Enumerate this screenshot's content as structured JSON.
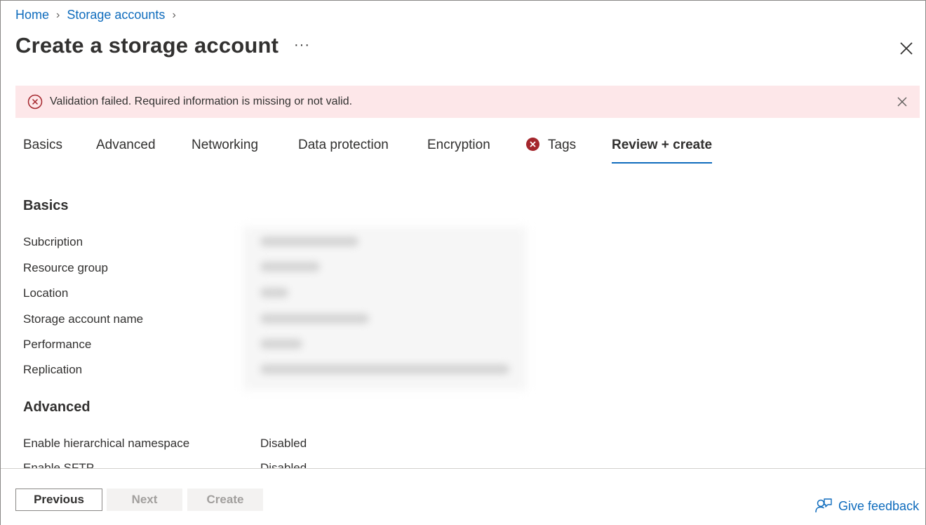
{
  "breadcrumb": {
    "home": "Home",
    "storage_accounts": "Storage accounts"
  },
  "page": {
    "title": "Create a storage account",
    "more": "···"
  },
  "banner": {
    "message": "Validation failed. Required information is missing or not valid."
  },
  "tabs": [
    {
      "label": "Basics"
    },
    {
      "label": "Advanced"
    },
    {
      "label": "Networking"
    },
    {
      "label": "Data protection"
    },
    {
      "label": "Encryption"
    },
    {
      "label": "Tags",
      "has_error": true
    },
    {
      "label": "Review + create",
      "active": true
    }
  ],
  "basics": {
    "heading": "Basics",
    "rows": [
      {
        "label": "Subcription"
      },
      {
        "label": "Resource group"
      },
      {
        "label": "Location"
      },
      {
        "label": "Storage account name"
      },
      {
        "label": "Performance"
      },
      {
        "label": "Replication"
      }
    ]
  },
  "advanced": {
    "heading": "Advanced",
    "rows": [
      {
        "label": "Enable hierarchical namespace",
        "value": "Disabled"
      },
      {
        "label": "Enable SFTP",
        "value": "Disabled"
      }
    ]
  },
  "footer": {
    "previous": "Previous",
    "next": "Next",
    "create": "Create",
    "feedback": "Give feedback"
  },
  "colors": {
    "link": "#0f6cbd",
    "error": "#a4262c",
    "banner_bg": "#fde7e9"
  }
}
